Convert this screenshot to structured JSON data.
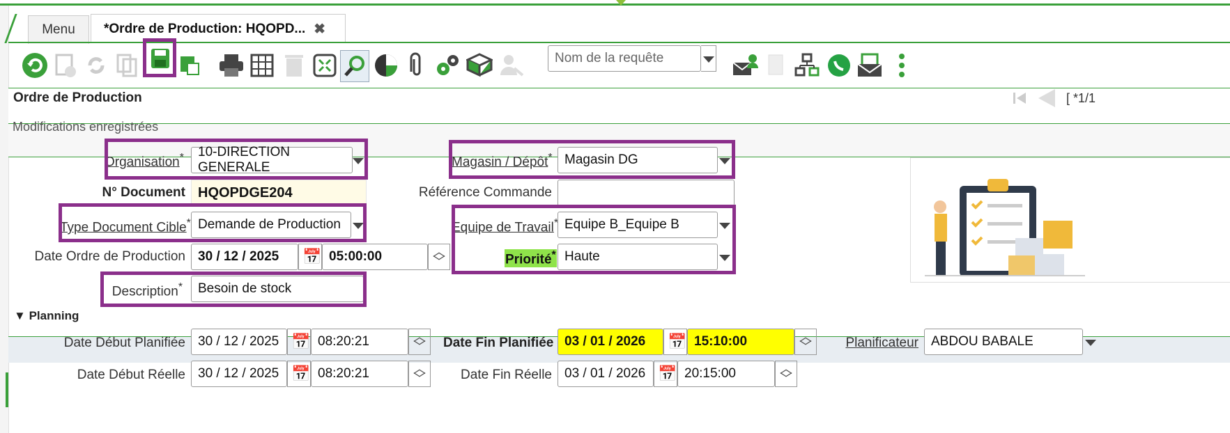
{
  "tabs": {
    "menu_label": "Menu",
    "active_label": "*Ordre de Production: HQOPD...",
    "close_glyph": "✖"
  },
  "toolbar": {
    "query_placeholder": "Nom de la requête"
  },
  "header": {
    "title": "Ordre de Production",
    "record_nav": "[ *1/1"
  },
  "status": {
    "message": "Modifications enregistrées"
  },
  "form": {
    "organisation_label": "Organisation",
    "organisation_value": "10-DIRECTION GENERALE",
    "magasin_label": "Magasin / Dépôt",
    "magasin_value": "Magasin DG",
    "document_label": "N° Document",
    "document_value": "HQOPDGE204",
    "reference_label": "Référence Commande",
    "reference_value": "",
    "type_doc_label": "Type Document Cible",
    "type_doc_value": "Demande de Production",
    "equipe_label": "Equipe de Travail",
    "equipe_value": "Equipe B_Equipe B",
    "date_op_label": "Date Ordre de Production",
    "date_op_value": "30 / 12 / 2025",
    "time_op_value": "05:00:00",
    "priorite_label": "Priorité",
    "priorite_value": "Haute",
    "description_label": "Description",
    "description_value": "Besoin de stock",
    "required_mark": "*"
  },
  "planning": {
    "title": "Planning",
    "date_debut_planifiee_label": "Date Début Planifiée",
    "date_debut_planifiee_value": "30 / 12 / 2025",
    "time_debut_planifiee_value": "08:20:21",
    "date_fin_planifiee_label": "Date Fin Planifiée",
    "date_fin_planifiee_value": "03 / 01 / 2026",
    "time_fin_planifiee_value": "15:10:00",
    "planificateur_label": "Planificateur",
    "planificateur_value": "ABDOU BABALE",
    "date_debut_reelle_label": "Date Début Réelle",
    "date_debut_reelle_value": "30 / 12 / 2025",
    "time_debut_reelle_value": "08:20:21",
    "date_fin_reelle_label": "Date Fin Réelle",
    "date_fin_reelle_value": "03 / 01 / 2026",
    "time_fin_reelle_value": "20:15:00"
  },
  "colors": {
    "accent_green": "#3aa03a",
    "highlight_purple": "#8b2f8b",
    "highlight_yellow": "#ffff00",
    "priority_green": "#8fe34a"
  }
}
